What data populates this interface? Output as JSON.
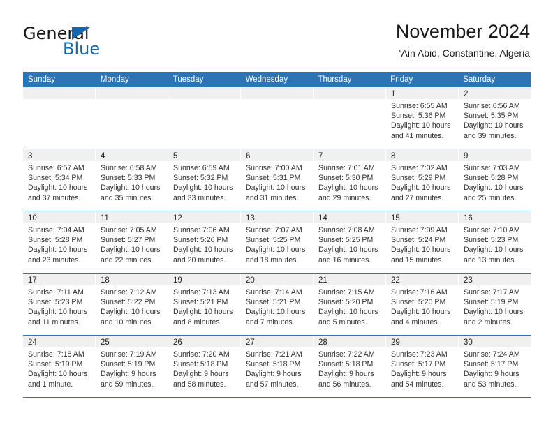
{
  "brand": {
    "word_one": "General",
    "word_two": "Blue",
    "accent_color": "#1267b2",
    "triangle_icon": "triangle-icon"
  },
  "header": {
    "title": "November 2024",
    "subtitle": "‘Ain Abid, Constantine, Algeria"
  },
  "calendar": {
    "header_bg": "#2e74b5",
    "day_band_bg": "#f0f0f0",
    "weekdays": [
      "Sunday",
      "Monday",
      "Tuesday",
      "Wednesday",
      "Thursday",
      "Friday",
      "Saturday"
    ],
    "weeks": [
      [
        {
          "day": "",
          "lines": []
        },
        {
          "day": "",
          "lines": []
        },
        {
          "day": "",
          "lines": []
        },
        {
          "day": "",
          "lines": []
        },
        {
          "day": "",
          "lines": []
        },
        {
          "day": "1",
          "lines": [
            "Sunrise: 6:55 AM",
            "Sunset: 5:36 PM",
            "Daylight: 10 hours",
            "and 41 minutes."
          ]
        },
        {
          "day": "2",
          "lines": [
            "Sunrise: 6:56 AM",
            "Sunset: 5:35 PM",
            "Daylight: 10 hours",
            "and 39 minutes."
          ]
        }
      ],
      [
        {
          "day": "3",
          "lines": [
            "Sunrise: 6:57 AM",
            "Sunset: 5:34 PM",
            "Daylight: 10 hours",
            "and 37 minutes."
          ]
        },
        {
          "day": "4",
          "lines": [
            "Sunrise: 6:58 AM",
            "Sunset: 5:33 PM",
            "Daylight: 10 hours",
            "and 35 minutes."
          ]
        },
        {
          "day": "5",
          "lines": [
            "Sunrise: 6:59 AM",
            "Sunset: 5:32 PM",
            "Daylight: 10 hours",
            "and 33 minutes."
          ]
        },
        {
          "day": "6",
          "lines": [
            "Sunrise: 7:00 AM",
            "Sunset: 5:31 PM",
            "Daylight: 10 hours",
            "and 31 minutes."
          ]
        },
        {
          "day": "7",
          "lines": [
            "Sunrise: 7:01 AM",
            "Sunset: 5:30 PM",
            "Daylight: 10 hours",
            "and 29 minutes."
          ]
        },
        {
          "day": "8",
          "lines": [
            "Sunrise: 7:02 AM",
            "Sunset: 5:29 PM",
            "Daylight: 10 hours",
            "and 27 minutes."
          ]
        },
        {
          "day": "9",
          "lines": [
            "Sunrise: 7:03 AM",
            "Sunset: 5:28 PM",
            "Daylight: 10 hours",
            "and 25 minutes."
          ]
        }
      ],
      [
        {
          "day": "10",
          "lines": [
            "Sunrise: 7:04 AM",
            "Sunset: 5:28 PM",
            "Daylight: 10 hours",
            "and 23 minutes."
          ]
        },
        {
          "day": "11",
          "lines": [
            "Sunrise: 7:05 AM",
            "Sunset: 5:27 PM",
            "Daylight: 10 hours",
            "and 22 minutes."
          ]
        },
        {
          "day": "12",
          "lines": [
            "Sunrise: 7:06 AM",
            "Sunset: 5:26 PM",
            "Daylight: 10 hours",
            "and 20 minutes."
          ]
        },
        {
          "day": "13",
          "lines": [
            "Sunrise: 7:07 AM",
            "Sunset: 5:25 PM",
            "Daylight: 10 hours",
            "and 18 minutes."
          ]
        },
        {
          "day": "14",
          "lines": [
            "Sunrise: 7:08 AM",
            "Sunset: 5:25 PM",
            "Daylight: 10 hours",
            "and 16 minutes."
          ]
        },
        {
          "day": "15",
          "lines": [
            "Sunrise: 7:09 AM",
            "Sunset: 5:24 PM",
            "Daylight: 10 hours",
            "and 15 minutes."
          ]
        },
        {
          "day": "16",
          "lines": [
            "Sunrise: 7:10 AM",
            "Sunset: 5:23 PM",
            "Daylight: 10 hours",
            "and 13 minutes."
          ]
        }
      ],
      [
        {
          "day": "17",
          "lines": [
            "Sunrise: 7:11 AM",
            "Sunset: 5:23 PM",
            "Daylight: 10 hours",
            "and 11 minutes."
          ]
        },
        {
          "day": "18",
          "lines": [
            "Sunrise: 7:12 AM",
            "Sunset: 5:22 PM",
            "Daylight: 10 hours",
            "and 10 minutes."
          ]
        },
        {
          "day": "19",
          "lines": [
            "Sunrise: 7:13 AM",
            "Sunset: 5:21 PM",
            "Daylight: 10 hours",
            "and 8 minutes."
          ]
        },
        {
          "day": "20",
          "lines": [
            "Sunrise: 7:14 AM",
            "Sunset: 5:21 PM",
            "Daylight: 10 hours",
            "and 7 minutes."
          ]
        },
        {
          "day": "21",
          "lines": [
            "Sunrise: 7:15 AM",
            "Sunset: 5:20 PM",
            "Daylight: 10 hours",
            "and 5 minutes."
          ]
        },
        {
          "day": "22",
          "lines": [
            "Sunrise: 7:16 AM",
            "Sunset: 5:20 PM",
            "Daylight: 10 hours",
            "and 4 minutes."
          ]
        },
        {
          "day": "23",
          "lines": [
            "Sunrise: 7:17 AM",
            "Sunset: 5:19 PM",
            "Daylight: 10 hours",
            "and 2 minutes."
          ]
        }
      ],
      [
        {
          "day": "24",
          "lines": [
            "Sunrise: 7:18 AM",
            "Sunset: 5:19 PM",
            "Daylight: 10 hours",
            "and 1 minute."
          ]
        },
        {
          "day": "25",
          "lines": [
            "Sunrise: 7:19 AM",
            "Sunset: 5:19 PM",
            "Daylight: 9 hours",
            "and 59 minutes."
          ]
        },
        {
          "day": "26",
          "lines": [
            "Sunrise: 7:20 AM",
            "Sunset: 5:18 PM",
            "Daylight: 9 hours",
            "and 58 minutes."
          ]
        },
        {
          "day": "27",
          "lines": [
            "Sunrise: 7:21 AM",
            "Sunset: 5:18 PM",
            "Daylight: 9 hours",
            "and 57 minutes."
          ]
        },
        {
          "day": "28",
          "lines": [
            "Sunrise: 7:22 AM",
            "Sunset: 5:18 PM",
            "Daylight: 9 hours",
            "and 56 minutes."
          ]
        },
        {
          "day": "29",
          "lines": [
            "Sunrise: 7:23 AM",
            "Sunset: 5:17 PM",
            "Daylight: 9 hours",
            "and 54 minutes."
          ]
        },
        {
          "day": "30",
          "lines": [
            "Sunrise: 7:24 AM",
            "Sunset: 5:17 PM",
            "Daylight: 9 hours",
            "and 53 minutes."
          ]
        }
      ]
    ]
  }
}
